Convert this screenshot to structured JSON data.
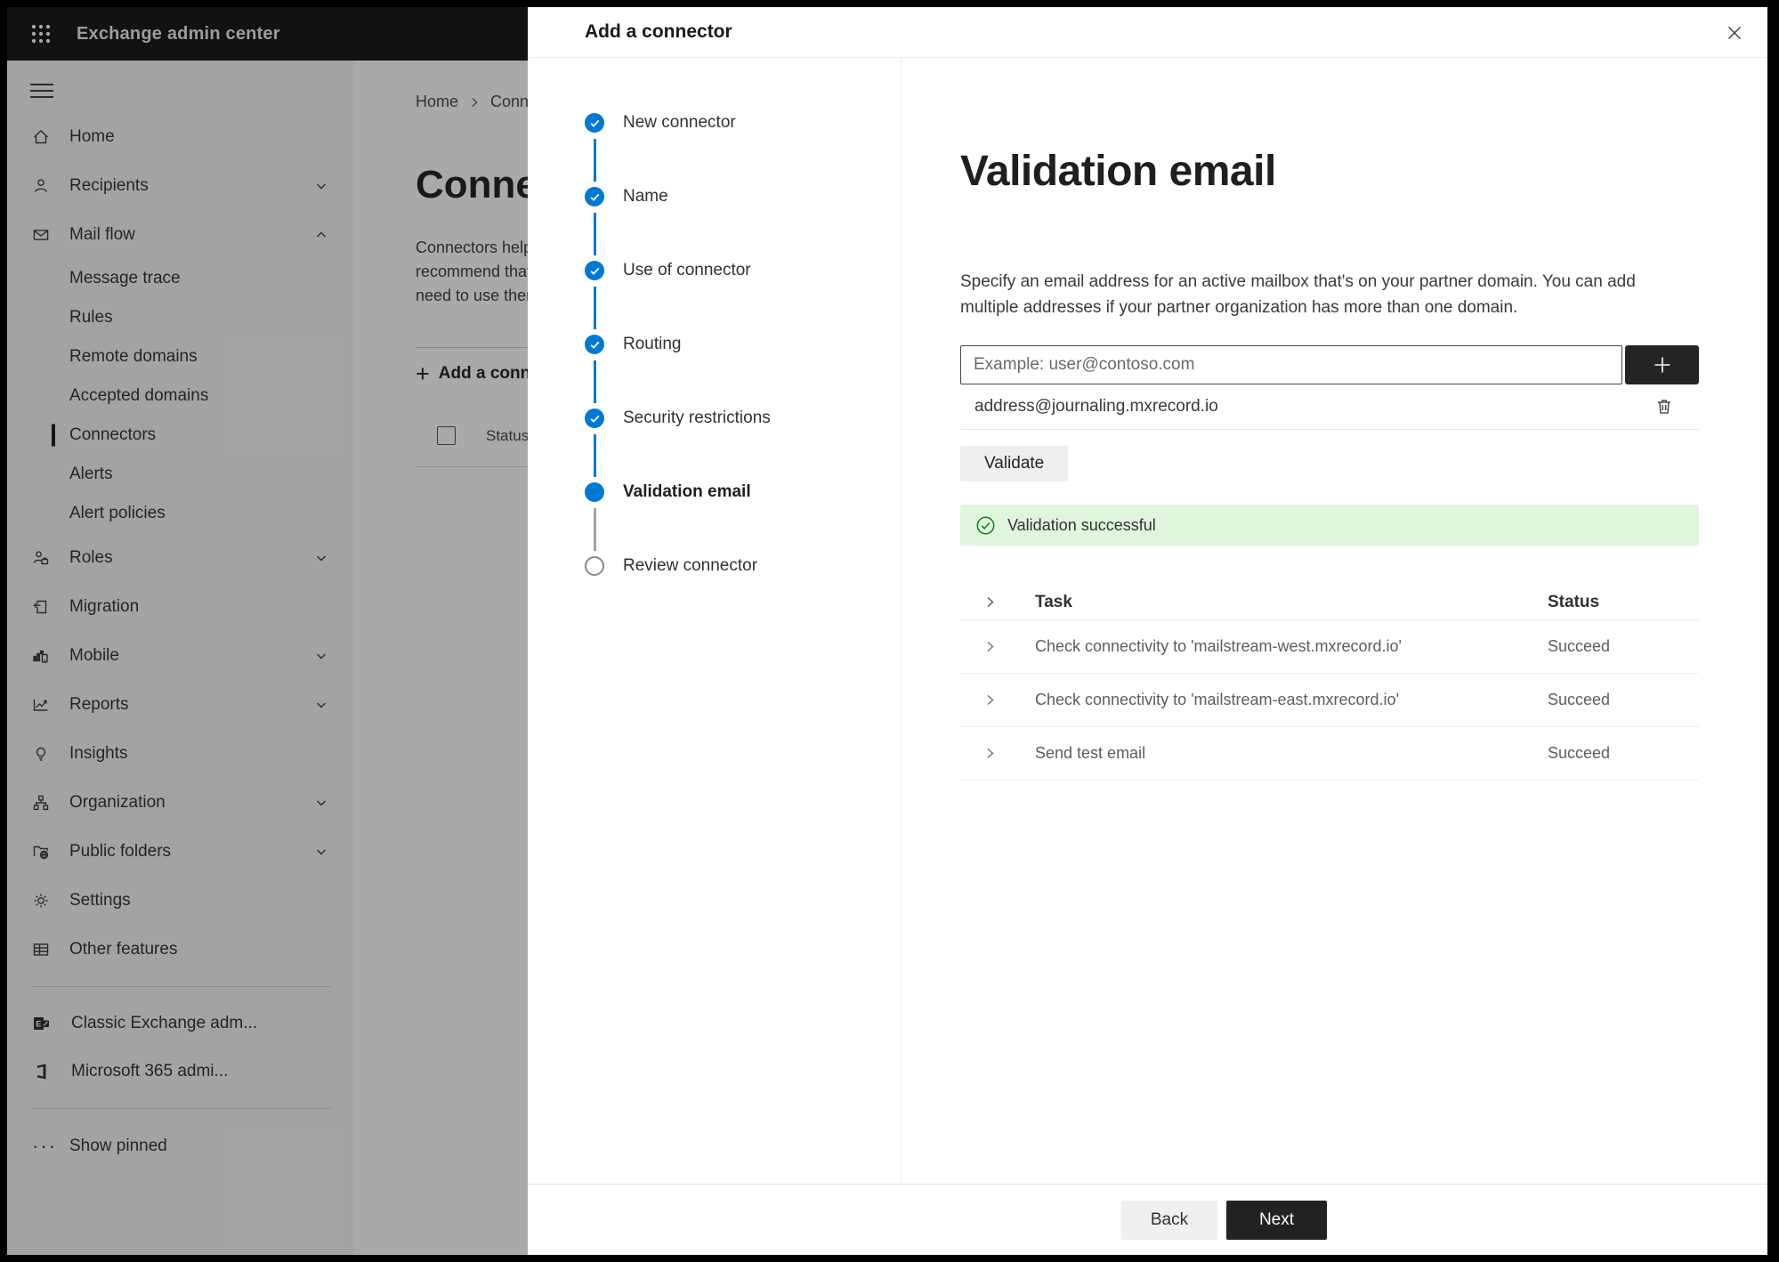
{
  "topbar": {
    "title": "Exchange admin center"
  },
  "sidebar": {
    "items": [
      {
        "label": "Home"
      },
      {
        "label": "Recipients"
      },
      {
        "label": "Mail flow"
      },
      {
        "label": "Message trace"
      },
      {
        "label": "Rules"
      },
      {
        "label": "Remote domains"
      },
      {
        "label": "Accepted domains"
      },
      {
        "label": "Connectors"
      },
      {
        "label": "Alerts"
      },
      {
        "label": "Alert policies"
      },
      {
        "label": "Roles"
      },
      {
        "label": "Migration"
      },
      {
        "label": "Mobile"
      },
      {
        "label": "Reports"
      },
      {
        "label": "Insights"
      },
      {
        "label": "Organization"
      },
      {
        "label": "Public folders"
      },
      {
        "label": "Settings"
      },
      {
        "label": "Other features"
      }
    ],
    "footer_items": [
      {
        "label": "Classic Exchange adm..."
      },
      {
        "label": "Microsoft 365 admi..."
      }
    ],
    "show_pinned": "Show pinned"
  },
  "background_page": {
    "breadcrumb_home": "Home",
    "breadcrumb_current": "Conne",
    "title": "Connect",
    "para_line1": "Connectors help",
    "para_line2": "recommend that",
    "para_line3": "need to use ther",
    "add_button": "Add a conn",
    "status_header": "Status"
  },
  "wizard": {
    "title": "Add a connector",
    "steps": [
      {
        "label": "New connector",
        "state": "done"
      },
      {
        "label": "Name",
        "state": "done"
      },
      {
        "label": "Use of connector",
        "state": "done"
      },
      {
        "label": "Routing",
        "state": "done"
      },
      {
        "label": "Security restrictions",
        "state": "done"
      },
      {
        "label": "Validation email",
        "state": "current"
      },
      {
        "label": "Review connector",
        "state": "todo"
      }
    ]
  },
  "main": {
    "heading": "Validation email",
    "description": "Specify an email address for an active mailbox that's on your partner domain. You can add multiple addresses if your partner organization has more than one domain.",
    "input_placeholder": "Example: user@contoso.com",
    "address": "address@journaling.mxrecord.io",
    "validate_label": "Validate",
    "banner_text": "Validation successful",
    "table": {
      "col_task": "Task",
      "col_status": "Status",
      "rows": [
        {
          "task": "Check connectivity to 'mailstream-west.mxrecord.io'",
          "status": "Succeed"
        },
        {
          "task": "Check connectivity to 'mailstream-east.mxrecord.io'",
          "status": "Succeed"
        },
        {
          "task": "Send test email",
          "status": "Succeed"
        }
      ]
    }
  },
  "footer": {
    "back": "Back",
    "next": "Next"
  },
  "colors": {
    "accent": "#0078d4",
    "success_bg": "#dff6dd",
    "success_green": "#107c10",
    "dark_button": "#232221"
  }
}
